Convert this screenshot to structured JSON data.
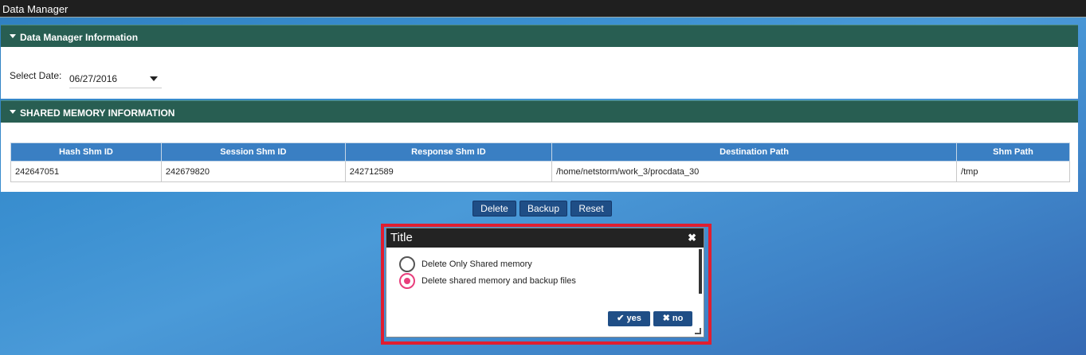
{
  "window": {
    "title": "Data Manager"
  },
  "info_panel": {
    "title": "Data Manager Information",
    "date_label": "Select Date:",
    "date_value": "06/27/2016"
  },
  "shm_panel": {
    "title": "SHARED MEMORY INFORMATION",
    "columns": [
      "Hash Shm ID",
      "Session Shm ID",
      "Response Shm ID",
      "Destination Path",
      "Shm Path"
    ],
    "rows": [
      [
        "242647051",
        "242679820",
        "242712589",
        "/home/netstorm/work_3/procdata_30",
        "/tmp"
      ]
    ]
  },
  "actions": {
    "delete": "Delete",
    "backup": "Backup",
    "reset": "Reset"
  },
  "dialog": {
    "title": "Title",
    "close": "✖",
    "options": [
      {
        "label": "Delete Only Shared memory",
        "selected": false
      },
      {
        "label": "Delete shared memory and backup files",
        "selected": true
      }
    ],
    "yes": "yes",
    "no": "no"
  },
  "colors": {
    "accent": "#1f4e86",
    "panel_header": "#285e52",
    "highlight": "#e01e30",
    "radio_on": "#e83e7c"
  }
}
